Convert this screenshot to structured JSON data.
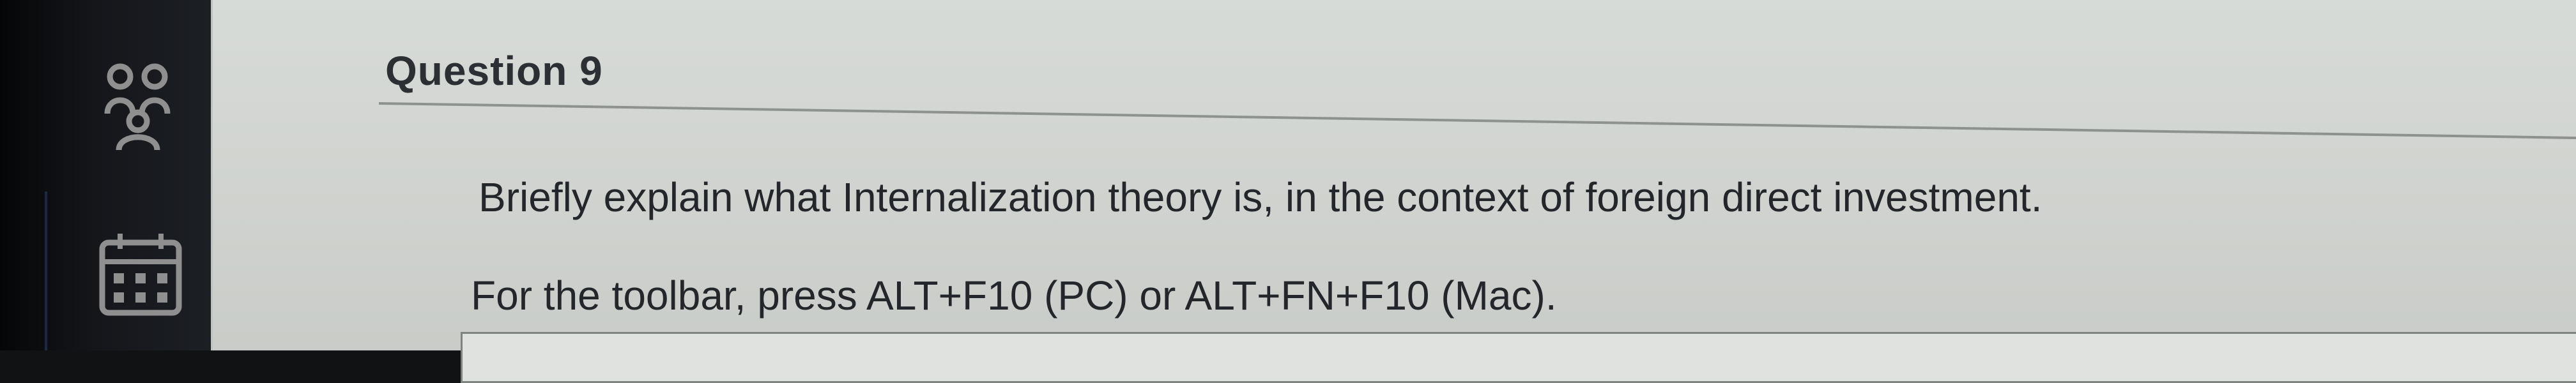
{
  "question": {
    "heading": "Question 9",
    "prompt": "Briefly explain what Internalization theory is, in the context of foreign direct investment.",
    "toolbar_hint": "For the toolbar, press ALT+F10 (PC) or ALT+FN+F10 (Mac).",
    "answer_value": ""
  },
  "sidebar": {
    "icons": [
      "people-icon",
      "calendar-icon"
    ]
  }
}
